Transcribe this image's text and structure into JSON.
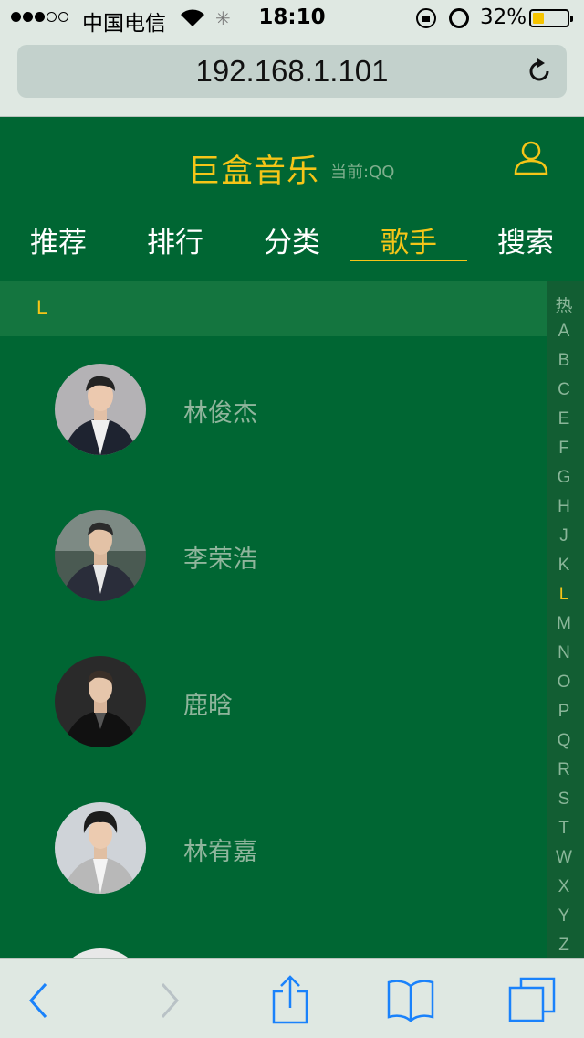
{
  "status_bar": {
    "carrier": "中国电信",
    "time": "18:10",
    "battery": "32%",
    "battery_level": 0.32
  },
  "browser": {
    "url": "192.168.1.101"
  },
  "header": {
    "title": "巨盒音乐",
    "subtitle": "当前:QQ"
  },
  "tabs": [
    {
      "label": "推荐",
      "active": false
    },
    {
      "label": "排行",
      "active": false
    },
    {
      "label": "分类",
      "active": false
    },
    {
      "label": "歌手",
      "active": true
    },
    {
      "label": "搜索",
      "active": false
    }
  ],
  "section": {
    "title": "L"
  },
  "singers": [
    {
      "name": "林俊杰"
    },
    {
      "name": "李荣浩"
    },
    {
      "name": "鹿晗"
    },
    {
      "name": "林宥嘉"
    }
  ],
  "alphabet_index": {
    "items": [
      "热",
      "A",
      "B",
      "C",
      "E",
      "F",
      "G",
      "H",
      "J",
      "K",
      "L",
      "M",
      "N",
      "O",
      "P",
      "Q",
      "R",
      "S",
      "T",
      "W",
      "X",
      "Y",
      "Z"
    ],
    "active": "L"
  },
  "colors": {
    "background": "#006633",
    "accent": "#f5c518",
    "section_bg": "#14753f",
    "ios_blue": "#1a82fb"
  }
}
